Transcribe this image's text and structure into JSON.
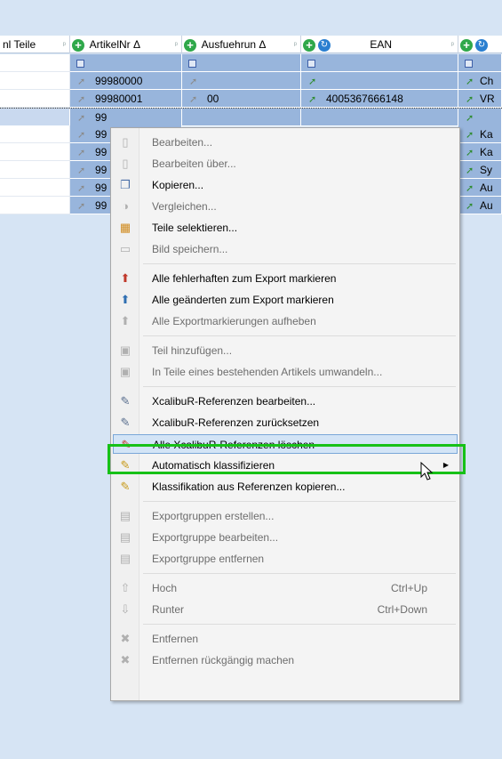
{
  "grid": {
    "headers": [
      {
        "label": "nl Teile"
      },
      {
        "label": "ArtikelNr  Δ"
      },
      {
        "label": "Ausfuehrun Δ"
      },
      {
        "label": "EAN"
      }
    ],
    "rows": [
      {
        "artikelnr": "",
        "ausfuehrung": "",
        "ean": "",
        "extra": ""
      },
      {
        "artikelnr": "99980000",
        "ausfuehrung": "",
        "ean": "",
        "extra": "Ch"
      },
      {
        "artikelnr": "99980001",
        "ausfuehrung": "00",
        "ean": "4005367666148",
        "extra": "VR"
      },
      {
        "artikelnr": "99",
        "ausfuehrung": "",
        "ean": "",
        "extra": ""
      },
      {
        "artikelnr": "99",
        "ausfuehrung": "",
        "ean": "",
        "extra": "Ka"
      },
      {
        "artikelnr": "99",
        "ausfuehrung": "",
        "ean": "",
        "extra": "Ka"
      },
      {
        "artikelnr": "99",
        "ausfuehrung": "",
        "ean": "",
        "extra": "Sy"
      },
      {
        "artikelnr": "99",
        "ausfuehrung": "",
        "ean": "",
        "extra": "Au"
      },
      {
        "artikelnr": "99",
        "ausfuehrung": "",
        "ean": "",
        "extra": "Au"
      }
    ]
  },
  "menu": {
    "items": [
      {
        "label": "Bearbeiten...",
        "disabled": true,
        "icon": "doc-icon"
      },
      {
        "label": "Bearbeiten über...",
        "disabled": true,
        "icon": "doc-icon"
      },
      {
        "label": "Kopieren...",
        "disabled": false,
        "icon": "copy-icon"
      },
      {
        "label": "Vergleichen...",
        "disabled": true,
        "icon": "compare-icon"
      },
      {
        "label": "Teile selektieren...",
        "disabled": false,
        "icon": "select-parts-icon"
      },
      {
        "label": "Bild speichern...",
        "disabled": true,
        "icon": "save-image-icon"
      },
      {
        "label": "Alle fehlerhaften zum Export markieren",
        "disabled": false,
        "icon": "export-mark-error-icon"
      },
      {
        "label": "Alle geänderten zum Export markieren",
        "disabled": false,
        "icon": "export-mark-changed-icon"
      },
      {
        "label": "Alle Exportmarkierungen aufheben",
        "disabled": true,
        "icon": "export-unmark-icon"
      },
      {
        "label": "Teil hinzufügen...",
        "disabled": true,
        "icon": "add-part-icon"
      },
      {
        "label": "In Teile eines bestehenden Artikels umwandeln...",
        "disabled": true,
        "icon": "convert-icon"
      },
      {
        "label": "XcalibuR-Referenzen bearbeiten...",
        "disabled": false,
        "icon": "xref-edit-icon"
      },
      {
        "label": "XcalibuR-Referenzen zurücksetzen",
        "disabled": false,
        "icon": "xref-reset-icon"
      },
      {
        "label": "Alle XcalibuR-Referenzen löschen",
        "disabled": false,
        "icon": "xref-delete-icon"
      },
      {
        "label": "Automatisch klassifizieren",
        "disabled": false,
        "icon": "auto-classify-icon"
      },
      {
        "label": "Klassifikation aus Referenzen kopieren...",
        "disabled": false,
        "icon": "copy-classification-icon"
      },
      {
        "label": "Exportgruppen erstellen...",
        "disabled": true,
        "icon": "exportgroup-create-icon"
      },
      {
        "label": "Exportgruppe bearbeiten...",
        "disabled": true,
        "icon": "exportgroup-edit-icon"
      },
      {
        "label": "Exportgruppe entfernen",
        "disabled": true,
        "icon": "exportgroup-remove-icon"
      },
      {
        "label": "Hoch",
        "shortcut": "Ctrl+Up",
        "disabled": true,
        "icon": "arrow-up-icon"
      },
      {
        "label": "Runter",
        "shortcut": "Ctrl+Down",
        "disabled": true,
        "icon": "arrow-down-icon"
      },
      {
        "label": "Entfernen",
        "disabled": true,
        "icon": "remove-icon"
      },
      {
        "label": "Entfernen rückgängig machen",
        "disabled": true,
        "icon": "undo-remove-icon"
      }
    ]
  }
}
